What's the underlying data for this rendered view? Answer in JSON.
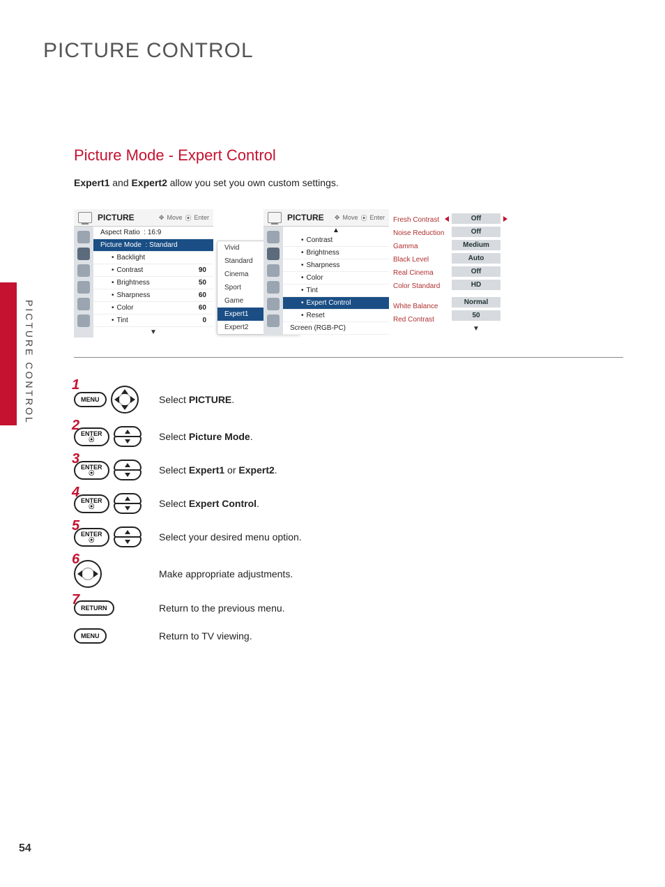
{
  "page": {
    "title": "PICTURE CONTROL",
    "side_label": "PICTURE CONTROL",
    "number": "54"
  },
  "section": {
    "title": "Picture Mode - Expert Control",
    "intro_bold1": "Expert1",
    "intro_and": " and ",
    "intro_bold2": "Expert2",
    "intro_rest": " allow you set you own custom settings."
  },
  "screen_left": {
    "title": "PICTURE",
    "hdr_move": "Move",
    "hdr_enter": "Enter",
    "aspect_label": "Aspect Ratio",
    "aspect_value": ": 16:9",
    "mode_label": "Picture Mode",
    "mode_value": ": Standard",
    "opts": [
      {
        "name": "Backlight",
        "val": ""
      },
      {
        "name": "Contrast",
        "val": "90"
      },
      {
        "name": "Brightness",
        "val": "50"
      },
      {
        "name": "Sharpness",
        "val": "60"
      },
      {
        "name": "Color",
        "val": "60"
      },
      {
        "name": "Tint",
        "val": "0"
      }
    ],
    "footer_arrow": "▼",
    "dropdown": [
      "Vivid",
      "Standard",
      "Cinema",
      "Sport",
      "Game",
      "Expert1",
      "Expert2"
    ],
    "dropdown_selected": "Expert1"
  },
  "screen_right": {
    "title": "PICTURE",
    "hdr_move": "Move",
    "hdr_enter": "Enter",
    "opts": [
      "Contrast",
      "Brightness",
      "Sharpness",
      "Color",
      "Tint",
      "Expert Control",
      "Reset"
    ],
    "highlight": "Expert Control",
    "footer_label": "Screen (RGB-PC)",
    "settings": [
      {
        "label": "Fresh Contrast",
        "value": "Off",
        "first": true
      },
      {
        "label": "Noise Reduction",
        "value": "Off"
      },
      {
        "label": "Gamma",
        "value": "Medium"
      },
      {
        "label": "Black Level",
        "value": "Auto"
      },
      {
        "label": "Real Cinema",
        "value": "Off"
      },
      {
        "label": "Color Standard",
        "value": "HD"
      },
      {
        "label": "White Balance",
        "value": "Normal",
        "gap": true
      },
      {
        "label": "Red Contrast",
        "value": "50"
      }
    ],
    "foot_arrow": "▼"
  },
  "btn": {
    "menu": "MENU",
    "enter": "ENTER",
    "return": "RETURN",
    "dot": "⦿"
  },
  "steps": [
    {
      "n": "1",
      "btns": [
        "menu",
        "dpad4"
      ],
      "t_pre": "Select ",
      "t_b": "PICTURE",
      "t_post": "."
    },
    {
      "n": "2",
      "btns": [
        "enter",
        "pills"
      ],
      "t_pre": "Select ",
      "t_b": "Picture Mode",
      "t_post": "."
    },
    {
      "n": "3",
      "btns": [
        "enter",
        "pills"
      ],
      "t_pre": "Select ",
      "t_b": "Expert1",
      "t_mid": " or ",
      "t_b2": "Expert2",
      "t_post": "."
    },
    {
      "n": "4",
      "btns": [
        "enter",
        "pills"
      ],
      "t_pre": "Select ",
      "t_b": "Expert Control",
      "t_post": "."
    },
    {
      "n": "5",
      "btns": [
        "enter",
        "pills"
      ],
      "t_pre": "Select your desired menu option.",
      "t_b": "",
      "t_post": ""
    },
    {
      "n": "6",
      "btns": [
        "dpadlr"
      ],
      "t_pre": "Make appropriate adjustments.",
      "t_b": "",
      "t_post": ""
    },
    {
      "n": "7",
      "btns": [
        "return"
      ],
      "t_pre": "Return to the previous menu.",
      "t_b": "",
      "t_post": ""
    },
    {
      "n": "",
      "btns": [
        "menu"
      ],
      "t_pre": "Return to TV viewing.",
      "t_b": "",
      "t_post": ""
    }
  ]
}
